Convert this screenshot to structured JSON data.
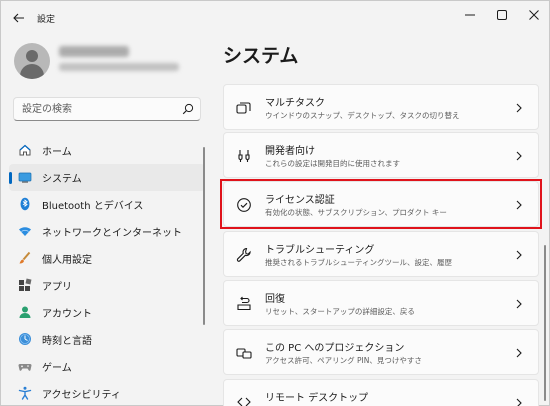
{
  "app": {
    "title": "設定"
  },
  "search": {
    "placeholder": "設定の検索"
  },
  "nav": {
    "items": [
      {
        "label": "ホーム",
        "icon": "home-icon"
      },
      {
        "label": "システム",
        "icon": "system-icon",
        "active": true
      },
      {
        "label": "Bluetooth とデバイス",
        "icon": "bluetooth-icon"
      },
      {
        "label": "ネットワークとインターネット",
        "icon": "wifi-icon"
      },
      {
        "label": "個人用設定",
        "icon": "brush-icon"
      },
      {
        "label": "アプリ",
        "icon": "apps-icon"
      },
      {
        "label": "アカウント",
        "icon": "account-icon"
      },
      {
        "label": "時刻と言語",
        "icon": "time-language-icon"
      },
      {
        "label": "ゲーム",
        "icon": "game-icon"
      },
      {
        "label": "アクセシビリティ",
        "icon": "accessibility-icon"
      }
    ]
  },
  "main": {
    "title": "システム",
    "cards": [
      {
        "title": "マルチタスク",
        "desc": "ウインドウのスナップ、デスクトップ、タスクの切り替え",
        "icon": "multitasking-icon"
      },
      {
        "title": "開発者向け",
        "desc": "これらの設定は開発目的に使用されます",
        "icon": "developer-icon"
      },
      {
        "title": "ライセンス認証",
        "desc": "有効化の状態、サブスクリプション、プロダクト キー",
        "icon": "activation-icon"
      },
      {
        "title": "トラブルシューティング",
        "desc": "推奨されるトラブルシューティングツール、設定、履歴",
        "icon": "wrench-icon"
      },
      {
        "title": "回復",
        "desc": "リセット、スタートアップの詳細設定、戻る",
        "icon": "recovery-icon"
      },
      {
        "title": "この PC へのプロジェクション",
        "desc": "アクセス許可、ペアリング PIN、見つけやすさ",
        "icon": "projection-icon"
      },
      {
        "title": "リモート デスクトップ",
        "desc": "",
        "icon": "remote-desktop-icon"
      }
    ]
  },
  "colors": {
    "accent": "#0067c0",
    "highlight": "#e0131b"
  }
}
